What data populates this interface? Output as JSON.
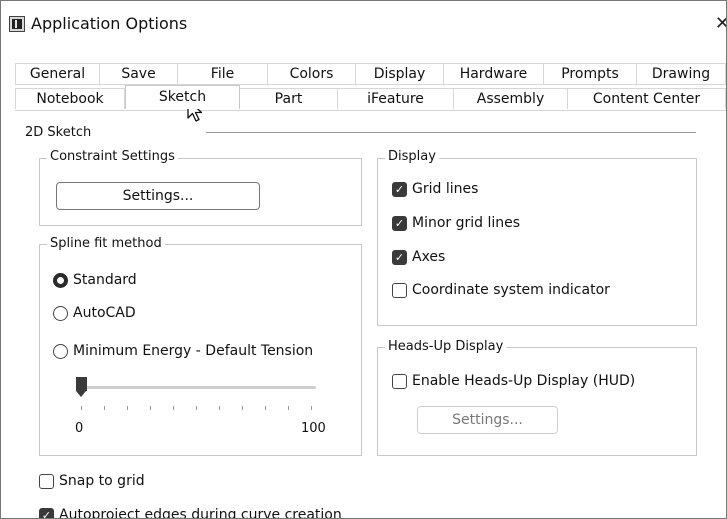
{
  "window": {
    "title": "Application Options",
    "close_glyph": "✕"
  },
  "tabs": {
    "row1": [
      "General",
      "Save",
      "File",
      "Colors",
      "Display",
      "Hardware",
      "Prompts",
      "Drawing"
    ],
    "row2": [
      "Notebook",
      "Sketch",
      "Part",
      "iFeature",
      "Assembly",
      "Content Center"
    ],
    "active": "Sketch"
  },
  "section_2d": "2D Sketch",
  "constraint": {
    "legend": "Constraint Settings",
    "settings_button": "Settings..."
  },
  "spline": {
    "legend": "Spline fit method",
    "options": [
      "Standard",
      "AutoCAD",
      "Minimum Energy - Default Tension"
    ],
    "selected": "Standard",
    "slider_min_label": "0",
    "slider_max_label": "100",
    "slider_value": 0
  },
  "display": {
    "legend": "Display",
    "grid_lines": "Grid lines",
    "minor_grid_lines": "Minor grid lines",
    "axes": "Axes",
    "coordinate_system_indicator": "Coordinate system indicator"
  },
  "hud": {
    "legend": "Heads-Up Display",
    "enable_label": "Enable Heads-Up Display (HUD)",
    "settings_button": "Settings..."
  },
  "bottom": {
    "snap_to_grid": "Snap to grid",
    "autoproject": "Autoproject edges during curve creation"
  },
  "icons": {
    "check": "check-icon",
    "close": "close-icon",
    "app": "app-icon",
    "cursor": "mouse-cursor-icon"
  },
  "colors": {
    "checked_fill": "#3a3a3a",
    "group_border": "#c8c8c8",
    "disabled_text": "#777777"
  }
}
